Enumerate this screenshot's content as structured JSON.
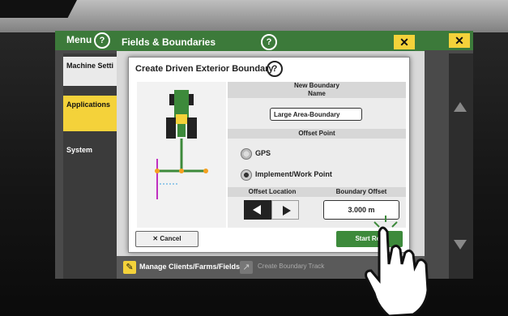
{
  "menu": {
    "title": "Menu"
  },
  "sidebar": {
    "items": [
      {
        "label": "Machine Setti"
      },
      {
        "label": "Applications"
      },
      {
        "label": "System"
      }
    ]
  },
  "fields_window": {
    "title": "Fields & Boundaries"
  },
  "bottom_bar": {
    "manage_label": "Manage Clients/Farms/Fields",
    "create_label": "Create Boundary Track"
  },
  "dialog": {
    "title": "Create Driven Exterior Boundary",
    "new_boundary_header": "New Boundary",
    "name_header": "Name",
    "name_value": "Large Area-Boundary",
    "offset_point_header": "Offset Point",
    "radio_gps": "GPS",
    "radio_implement": "Implement/Work Point",
    "selected_offset_point": "Implement/Work Point",
    "offset_location_header": "Offset Location",
    "boundary_offset_header": "Boundary Offset",
    "boundary_offset_value": "3.000 m",
    "cancel_label": "Cancel",
    "start_label": "Start Rec"
  },
  "colors": {
    "accent_green": "#3c7a3a",
    "button_green": "#3d8a3b",
    "highlight_yellow": "#f4d23a"
  }
}
